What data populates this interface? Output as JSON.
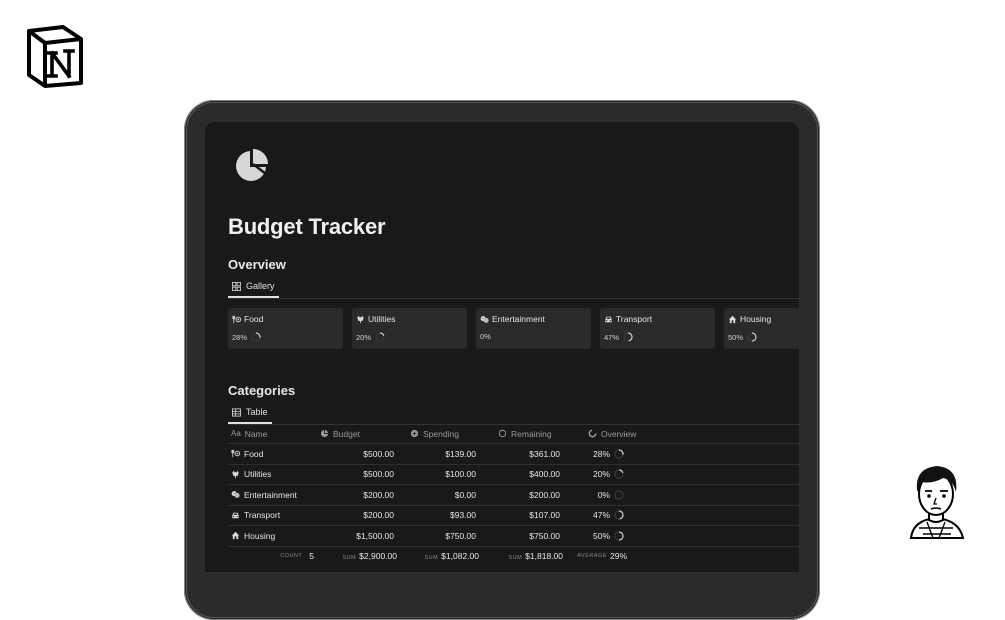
{
  "page": {
    "title": "Budget Tracker"
  },
  "overview": {
    "section_title": "Overview",
    "view_label": "Gallery",
    "cards": [
      {
        "name": "Food",
        "percent_label": "28%",
        "percent": 28,
        "icon": "fork-knife-icon"
      },
      {
        "name": "Utilities",
        "percent_label": "20%",
        "percent": 20,
        "icon": "plug-icon"
      },
      {
        "name": "Entertainment",
        "percent_label": "0%",
        "percent": 0,
        "icon": "theater-masks-icon"
      },
      {
        "name": "Transport",
        "percent_label": "47%",
        "percent": 47,
        "icon": "car-icon"
      },
      {
        "name": "Housing",
        "percent_label": "50%",
        "percent": 50,
        "icon": "house-icon"
      }
    ]
  },
  "categories": {
    "section_title": "Categories",
    "view_label": "Table",
    "columns": {
      "name_prefix": "Aa",
      "name": "Name",
      "budget": "Budget",
      "spending": "Spending",
      "remaining": "Remaining",
      "overview": "Overview"
    },
    "rows": [
      {
        "name": "Food",
        "budget": "$500.00",
        "spending": "$139.00",
        "remaining": "$361.00",
        "overview_label": "28%",
        "overview": 28,
        "icon": "fork-knife-icon"
      },
      {
        "name": "Utilities",
        "budget": "$500.00",
        "spending": "$100.00",
        "remaining": "$400.00",
        "overview_label": "20%",
        "overview": 20,
        "icon": "plug-icon"
      },
      {
        "name": "Entertainment",
        "budget": "$200.00",
        "spending": "$0.00",
        "remaining": "$200.00",
        "overview_label": "0%",
        "overview": 0,
        "icon": "theater-masks-icon"
      },
      {
        "name": "Transport",
        "budget": "$200.00",
        "spending": "$93.00",
        "remaining": "$107.00",
        "overview_label": "47%",
        "overview": 47,
        "icon": "car-icon"
      },
      {
        "name": "Housing",
        "budget": "$1,500.00",
        "spending": "$750.00",
        "remaining": "$750.00",
        "overview_label": "50%",
        "overview": 50,
        "icon": "house-icon"
      }
    ],
    "footer": {
      "count_label": "COUNT",
      "count_value": "5",
      "budget_label": "SUM",
      "budget_value": "$2,900.00",
      "spending_label": "SUM",
      "spending_value": "$1,082.00",
      "remaining_label": "SUM",
      "remaining_value": "$1,818.00",
      "overview_label": "AVERAGE",
      "overview_value": "29%"
    }
  },
  "colors": {
    "screen_bg": "#191919",
    "card_bg": "#2a2a2a",
    "text": "#e6e6e6",
    "muted": "#9a9a9a"
  }
}
